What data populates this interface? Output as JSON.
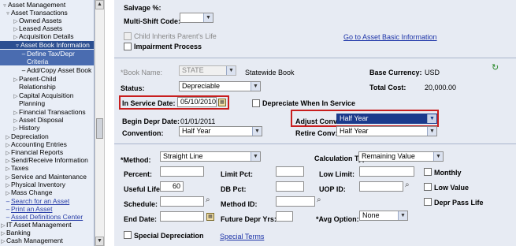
{
  "nav": {
    "items": [
      {
        "label": "Asset Management",
        "type": "folder-open"
      },
      {
        "label": "Asset Transactions",
        "type": "folder-open"
      },
      {
        "label": "Owned Assets",
        "type": "folder"
      },
      {
        "label": "Leased Assets",
        "type": "folder"
      },
      {
        "label": "Acquisition Details",
        "type": "folder"
      },
      {
        "label": "Asset Book Information",
        "type": "selected"
      },
      {
        "label": "Define Tax/Depr",
        "type": "sub"
      },
      {
        "label": "Criteria",
        "type": "sub-cont"
      },
      {
        "label": "Add/Copy Asset Book",
        "type": "link"
      },
      {
        "label": "Parent-Child",
        "type": "folder"
      },
      {
        "label": "Relationship",
        "type": "cont"
      },
      {
        "label": "Capital Acquisition",
        "type": "folder"
      },
      {
        "label": "Planning",
        "type": "cont"
      },
      {
        "label": "Financial Transactions",
        "type": "folder"
      },
      {
        "label": "Asset Disposal",
        "type": "folder"
      },
      {
        "label": "History",
        "type": "folder"
      },
      {
        "label": "Depreciation",
        "type": "folder1"
      },
      {
        "label": "Accounting Entries",
        "type": "folder1"
      },
      {
        "label": "Financial Reports",
        "type": "folder1"
      },
      {
        "label": "Send/Receive Information",
        "type": "folder1"
      },
      {
        "label": "Taxes",
        "type": "folder1"
      },
      {
        "label": "Service and Maintenance",
        "type": "folder1"
      },
      {
        "label": "Physical Inventory",
        "type": "folder1"
      },
      {
        "label": "Mass Change",
        "type": "folder1"
      },
      {
        "label": "Search for an Asset",
        "type": "link1"
      },
      {
        "label": "Print an Asset",
        "type": "link1"
      },
      {
        "label": "Asset Definitions Center",
        "type": "link1"
      },
      {
        "label": "IT Asset Management",
        "type": "folder0"
      },
      {
        "label": "Banking",
        "type": "folder0"
      },
      {
        "label": "Cash Management",
        "type": "folder0"
      }
    ]
  },
  "form": {
    "salvage_label": "Salvage %:",
    "multi_shift_label": "Multi-Shift Code:",
    "child_inherits_label": "Child Inherits Parent's Life",
    "goto_basic_link": "Go to Asset Basic Information",
    "impairment_label": "Impairment Process",
    "book_name_label": "*Book Name:",
    "book_name_value": "STATE",
    "book_name_desc": "Statewide Book",
    "base_currency_label": "Base Currency:",
    "base_currency_value": "USD",
    "status_label": "Status:",
    "status_value": "Depreciable",
    "total_cost_label": "Total Cost:",
    "total_cost_value": "20,000.00",
    "in_service_label": "In Service Date:",
    "in_service_value": "05/10/2010",
    "depr_when_in_service_label": "Depreciate When In Service",
    "begin_depr_label": "Begin Depr Date:",
    "begin_depr_value": "01/01/2011",
    "adjust_conv_label": "Adjust Conv:",
    "adjust_conv_value": "Half Year",
    "convention_label": "Convention:",
    "convention_value": "Half Year",
    "retire_conv_label": "Retire Conv:",
    "retire_conv_value": "Half Year",
    "method_label": "*Method:",
    "method_value": "Straight Line",
    "calc_type_label": "Calculation Type:",
    "calc_type_value": "Remaining Value",
    "percent_label": "Percent:",
    "limit_pct_label": "Limit Pct:",
    "low_limit_label": "Low Limit:",
    "monthly_label": "Monthly",
    "useful_life_label": "Useful Life:",
    "useful_life_value": "60",
    "db_pct_label": "DB Pct:",
    "uop_id_label": "UOP ID:",
    "low_value_label": "Low Value",
    "schedule_label": "Schedule:",
    "method_id_label": "Method ID:",
    "depr_pass_life_label": "Depr Pass Life",
    "end_date_label": "End Date:",
    "future_depr_label": "Future Depr Yrs:",
    "avg_option_label": "*Avg Option:",
    "avg_option_value": "None",
    "special_depr_label": "Special Depreciation",
    "special_terms_link": "Special Terms"
  },
  "icons": {
    "refresh": "refresh-icon",
    "calendar": "calendar-icon",
    "lookup": "lookup-icon"
  }
}
